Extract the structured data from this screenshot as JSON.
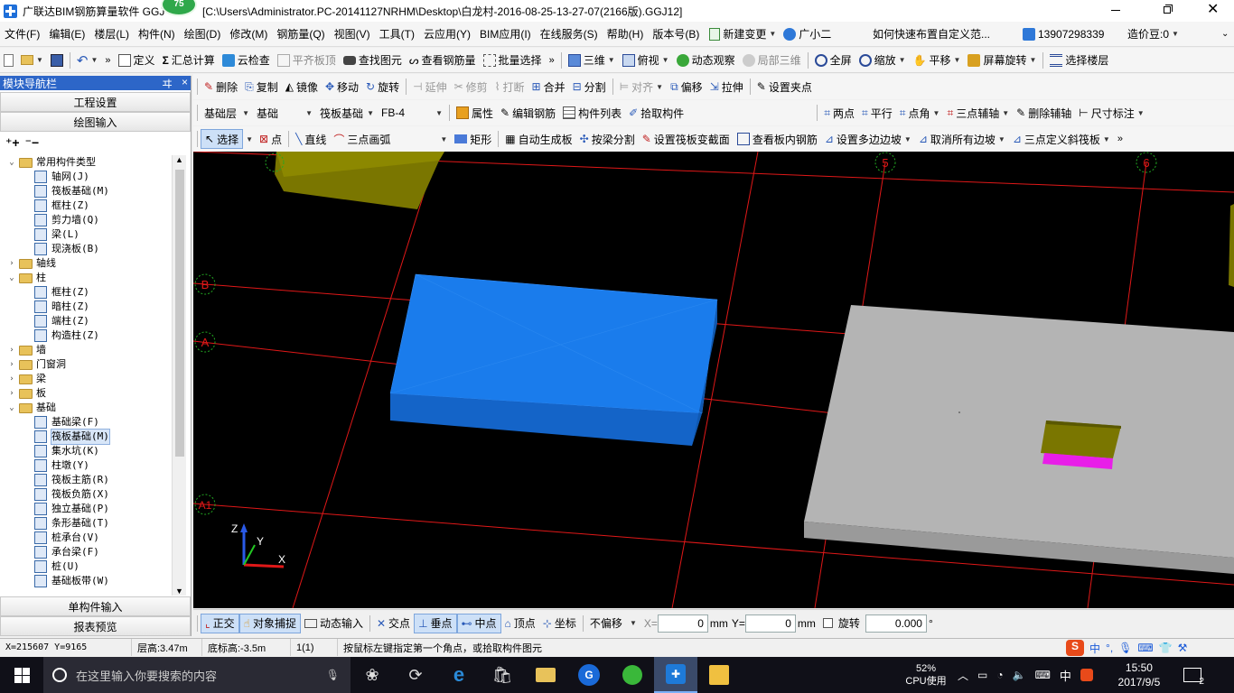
{
  "titlebar": {
    "app_title": "广联达BIM钢筋算量软件 GGJ",
    "badge": "75",
    "file_path": "[C:\\Users\\Administrator.PC-20141127NRHM\\Desktop\\白龙村-2016-08-25-13-27-07(2166版).GGJ12]"
  },
  "menu": {
    "items": [
      "文件(F)",
      "编辑(E)",
      "楼层(L)",
      "构件(N)",
      "绘图(D)",
      "修改(M)",
      "钢筋量(Q)",
      "视图(V)",
      "工具(T)",
      "云应用(Y)",
      "BIM应用(I)",
      "在线服务(S)",
      "帮助(H)",
      "版本号(B)"
    ],
    "new_change": "新建变更",
    "guangxiaoer": "广小二",
    "help_link": "如何快速布置自定义范...",
    "phone": "13907298339",
    "price_bean": "造价豆:0"
  },
  "toolbar1": {
    "define": "定义",
    "sum": "汇总计算",
    "cloud_check": "云检查",
    "flush_top": "平齐板顶",
    "find": "查找图元",
    "view_rebar": "查看钢筋量",
    "batch_select": "批量选择",
    "view3d": "三维",
    "top_view": "俯视",
    "dynamic": "动态观察",
    "local3d": "局部三维",
    "fullscreen": "全屏",
    "zoom": "缩放",
    "pan": "平移",
    "rotate_screen": "屏幕旋转",
    "select_floor": "选择楼层"
  },
  "nav": {
    "title": "模块导航栏",
    "pin": "ヰ",
    "close": "×",
    "project_settings": "工程设置",
    "drawing_input": "绘图输入",
    "single_input": "单构件输入",
    "report_preview": "报表预览",
    "tree": [
      {
        "label": "常用构件类型",
        "level": 0,
        "exp": "⌄",
        "type": "folder"
      },
      {
        "label": "轴网(J)",
        "level": 1,
        "type": "comp"
      },
      {
        "label": "筏板基础(M)",
        "level": 1,
        "type": "comp"
      },
      {
        "label": "框柱(Z)",
        "level": 1,
        "type": "comp"
      },
      {
        "label": "剪力墙(Q)",
        "level": 1,
        "type": "comp"
      },
      {
        "label": "梁(L)",
        "level": 1,
        "type": "comp"
      },
      {
        "label": "现浇板(B)",
        "level": 1,
        "type": "comp"
      },
      {
        "label": "轴线",
        "level": 0,
        "exp": "›",
        "type": "folder"
      },
      {
        "label": "柱",
        "level": 0,
        "exp": "⌄",
        "type": "folder"
      },
      {
        "label": "框柱(Z)",
        "level": 1,
        "type": "comp"
      },
      {
        "label": "暗柱(Z)",
        "level": 1,
        "type": "comp"
      },
      {
        "label": "端柱(Z)",
        "level": 1,
        "type": "comp"
      },
      {
        "label": "构造柱(Z)",
        "level": 1,
        "type": "comp"
      },
      {
        "label": "墙",
        "level": 0,
        "exp": "›",
        "type": "folder"
      },
      {
        "label": "门窗洞",
        "level": 0,
        "exp": "›",
        "type": "folder"
      },
      {
        "label": "梁",
        "level": 0,
        "exp": "›",
        "type": "folder"
      },
      {
        "label": "板",
        "level": 0,
        "exp": "›",
        "type": "folder"
      },
      {
        "label": "基础",
        "level": 0,
        "exp": "⌄",
        "type": "folder"
      },
      {
        "label": "基础梁(F)",
        "level": 1,
        "type": "comp"
      },
      {
        "label": "筏板基础(M)",
        "level": 1,
        "type": "comp",
        "selected": true
      },
      {
        "label": "集水坑(K)",
        "level": 1,
        "type": "comp"
      },
      {
        "label": "柱墩(Y)",
        "level": 1,
        "type": "comp"
      },
      {
        "label": "筏板主筋(R)",
        "level": 1,
        "type": "comp"
      },
      {
        "label": "筏板负筋(X)",
        "level": 1,
        "type": "comp"
      },
      {
        "label": "独立基础(P)",
        "level": 1,
        "type": "comp"
      },
      {
        "label": "条形基础(T)",
        "level": 1,
        "type": "comp"
      },
      {
        "label": "桩承台(V)",
        "level": 1,
        "type": "comp"
      },
      {
        "label": "承台梁(F)",
        "level": 1,
        "type": "comp"
      },
      {
        "label": "桩(U)",
        "level": 1,
        "type": "comp"
      },
      {
        "label": "基础板带(W)",
        "level": 1,
        "type": "comp"
      }
    ]
  },
  "toolbar2": {
    "delete": "删除",
    "copy": "复制",
    "mirror": "镜像",
    "move": "移动",
    "rotate": "旋转",
    "extend": "延伸",
    "trim": "修剪",
    "break": "打断",
    "merge": "合并",
    "split": "分割",
    "align": "对齐",
    "offset": "偏移",
    "stretch": "拉伸",
    "set_grip": "设置夹点"
  },
  "toolbar3": {
    "layer": "基础层",
    "category": "基础",
    "type": "筏板基础",
    "name": "FB-4",
    "properties": "属性",
    "edit_rebar": "编辑钢筋",
    "comp_list": "构件列表",
    "pick": "拾取构件",
    "two_points": "两点",
    "parallel": "平行",
    "point_angle": "点角",
    "three_aux": "三点辅轴",
    "del_aux": "删除辅轴",
    "dim": "尺寸标注"
  },
  "toolbar4": {
    "select": "选择",
    "point": "点",
    "line": "直线",
    "arc": "三点画弧",
    "rect": "矩形",
    "auto_gen": "自动生成板",
    "split_by_beam": "按梁分割",
    "set_section": "设置筏板变截面",
    "view_rebar": "查看板内钢筋",
    "set_slope": "设置多边边坡",
    "cancel_slope": "取消所有边坡",
    "three_point_slope": "三点定义斜筏板"
  },
  "axes": {
    "top": [
      "5",
      "6"
    ],
    "left": [
      "B",
      "A",
      "A1"
    ]
  },
  "status": {
    "ortho": "正交",
    "snap": "对象捕捉",
    "dyn_input": "动态输入",
    "intersection": "交点",
    "perpendicular": "垂点",
    "midpoint": "中点",
    "vertex": "顶点",
    "coord": "坐标",
    "no_offset": "不偏移",
    "x_label": "X=",
    "x_val": "0",
    "mm1": "mm",
    "y_label": "Y=",
    "y_val": "0",
    "mm2": "mm",
    "rotate": "旋转",
    "rotate_val": "0.000",
    "degree": "°"
  },
  "coordbar": {
    "xy": "X=215607 Y=9165",
    "floor_height": "层高:3.47m",
    "bottom_height": "底标高:-3.5m",
    "scale": "1(1)",
    "hint": "按鼠标左键指定第一个角点，或拾取构件图元"
  },
  "taskbar": {
    "search_placeholder": "在这里输入你要搜索的内容",
    "cpu_pct": "52%",
    "cpu_label": "CPU使用",
    "ime": "中",
    "time": "15:50",
    "date": "2017/9/5",
    "notif_count": "2"
  },
  "colors": {
    "slab_blue": "#1a7cec",
    "slab_grey": "#b4b4b4",
    "column_olive": "#7a7600",
    "magenta": "#e81ee8",
    "axis_red": "#e01818",
    "axis_green": "#22a822"
  }
}
